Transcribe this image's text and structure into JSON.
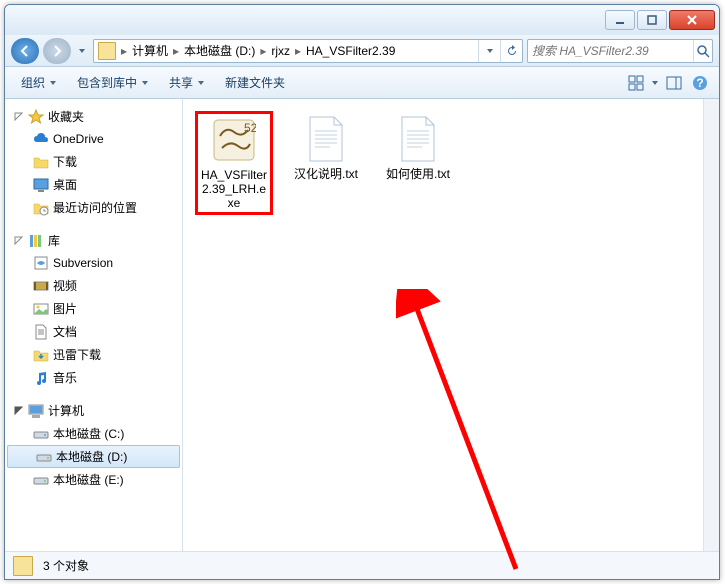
{
  "breadcrumb": {
    "items": [
      "计算机",
      "本地磁盘 (D:)",
      "rjxz",
      "HA_VSFilter2.39"
    ]
  },
  "search": {
    "placeholder": "搜索 HA_VSFilter2.39"
  },
  "toolbar": {
    "organize": "组织",
    "include": "包含到库中",
    "share": "共享",
    "newfolder": "新建文件夹"
  },
  "sidebar": {
    "favorites": {
      "label": "收藏夹",
      "items": [
        "OneDrive",
        "下载",
        "桌面",
        "最近访问的位置"
      ]
    },
    "libraries": {
      "label": "库",
      "items": [
        "Subversion",
        "视频",
        "图片",
        "文档",
        "迅雷下载",
        "音乐"
      ]
    },
    "computer": {
      "label": "计算机",
      "items": [
        "本地磁盘 (C:)",
        "本地磁盘 (D:)",
        "本地磁盘 (E:)"
      ]
    }
  },
  "files": [
    {
      "name": "HA_VSFilter2.39_LRH.exe",
      "type": "exe",
      "highlighted": true
    },
    {
      "name": "汉化说明.txt",
      "type": "txt",
      "highlighted": false
    },
    {
      "name": "如何使用.txt",
      "type": "txt",
      "highlighted": false
    }
  ],
  "statusbar": {
    "text": "3 个对象"
  }
}
